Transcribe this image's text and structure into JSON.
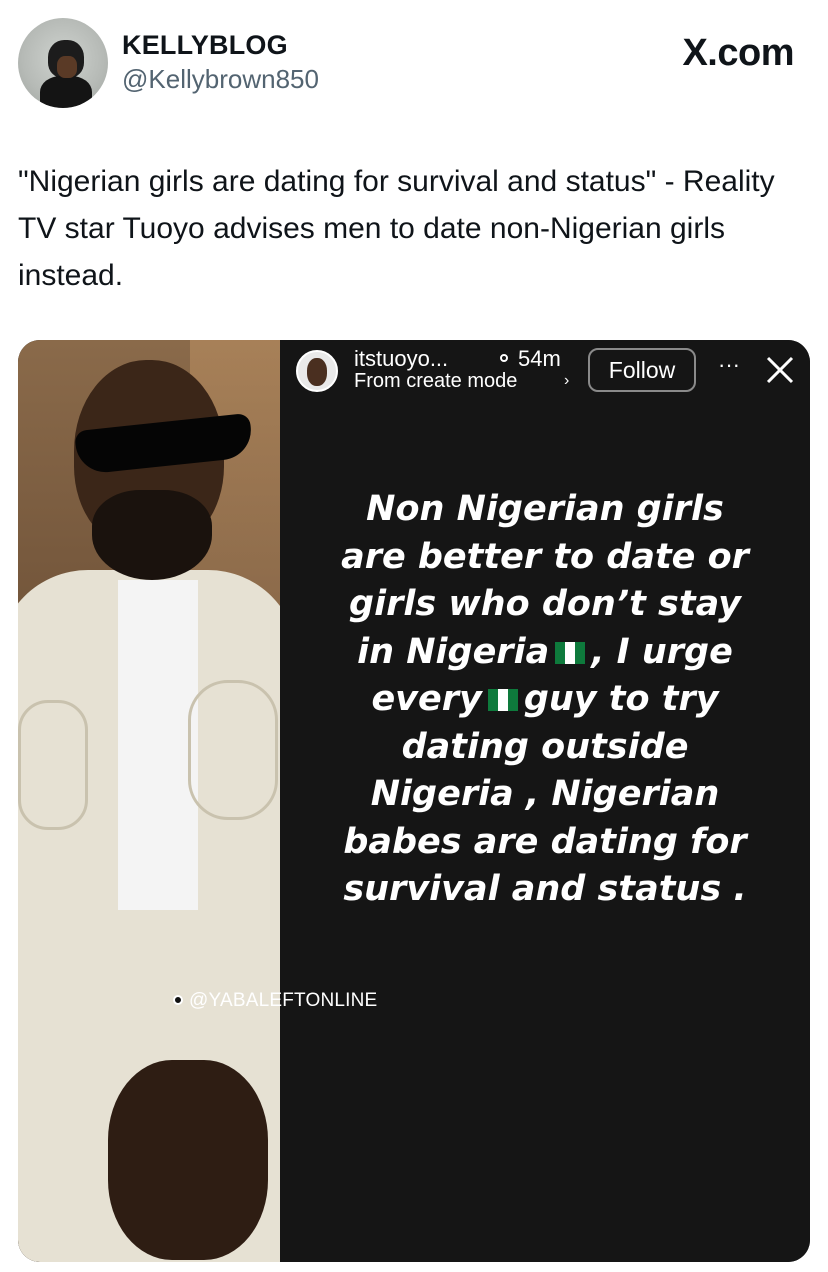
{
  "post": {
    "display_name": "KELLYBLOG",
    "handle": "@Kellybrown850",
    "site_label": "X.com",
    "text": "\"Nigerian girls are dating for survival and status\" - Reality TV star Tuoyo advises men to date non-Nigerian girls instead."
  },
  "story": {
    "username": "itstuoyo...",
    "time": "54m",
    "subtitle": "From create mode",
    "follow_label": "Follow",
    "more_icon": "more-dots-icon",
    "close_icon": "close-icon",
    "lines": {
      "l1": "Non Nigerian girls",
      "l2": "are better to date or",
      "l3": "girls who don’t stay",
      "l4a": "in Nigeria",
      "l4b": ", I urge",
      "l5a": "every",
      "l5b": "guy to try",
      "l6": "dating outside",
      "l7": "Nigeria , Nigerian",
      "l8": "babes are dating for",
      "l9": "survival and status ."
    },
    "flag_colors": {
      "green": "#0e7a3c",
      "white": "#ffffff"
    }
  },
  "watermark": "@YABALEFTONLINE"
}
